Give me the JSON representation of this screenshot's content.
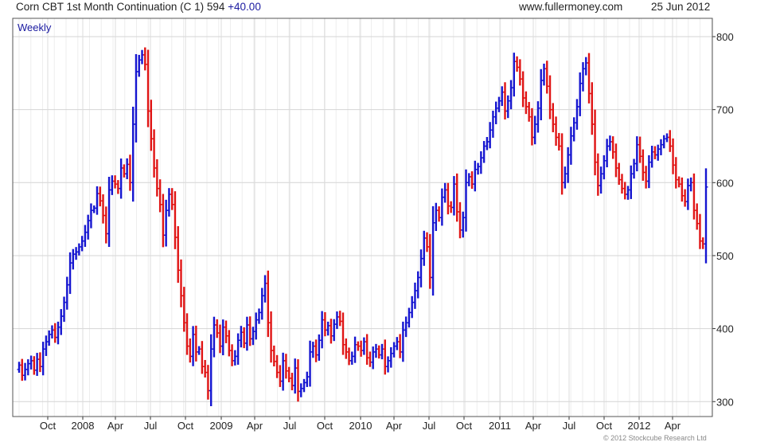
{
  "header": {
    "title_main": "Corn CBT 1st Month Continuation (C 1) 594",
    "title_change": "+40.00",
    "source": "www.fullermoney.com",
    "date": "25 Jun 2012"
  },
  "chart_label": "Weekly",
  "copyright": "© 2012 Stockcube Research Ltd",
  "colors": {
    "up": "#1515d0",
    "down": "#e01414",
    "grid": "#d4d4d4",
    "axis": "#333333"
  },
  "chart_data": {
    "type": "ohlc-bar",
    "title": "Corn CBT 1st Month Continuation (C 1) 594 +40.00",
    "period": "Weekly",
    "ylim": [
      280,
      810
    ],
    "yticks": [
      300,
      400,
      500,
      600,
      700,
      800
    ],
    "xlabels": [
      "Oct",
      "2008",
      "Apr",
      "Jul",
      "Oct",
      "2009",
      "Apr",
      "Jul",
      "Oct",
      "2010",
      "Apr",
      "Jul",
      "Oct",
      "2011",
      "Apr",
      "Jul",
      "Oct",
      "2012",
      "Apr"
    ],
    "grid": true,
    "legend": "none",
    "closes": [
      350,
      336,
      344,
      352,
      356,
      343,
      358,
      348,
      372,
      382,
      392,
      398,
      388,
      402,
      417,
      436,
      460,
      490,
      502,
      505,
      512,
      520,
      532,
      548,
      562,
      565,
      585,
      575,
      555,
      530,
      590,
      602,
      598,
      592,
      620,
      612,
      625,
      600,
      680,
      752,
      768,
      775,
      762,
      698,
      660,
      620,
      592,
      570,
      528,
      562,
      584,
      570,
      525,
      480,
      445,
      408,
      376,
      362,
      392,
      368,
      372,
      348,
      340,
      315,
      372,
      405,
      394,
      376,
      402,
      390,
      370,
      356,
      362,
      384,
      395,
      380,
      405,
      386,
      396,
      412,
      422,
      445,
      462,
      408,
      370,
      355,
      340,
      328,
      356,
      342,
      332,
      322,
      346,
      314,
      318,
      326,
      334,
      368,
      376,
      364,
      384,
      412,
      398,
      404,
      390,
      406,
      416,
      410,
      378,
      368,
      356,
      362,
      378,
      376,
      370,
      382,
      360,
      354,
      368,
      372,
      364,
      372,
      348,
      356,
      366,
      376,
      382,
      368,
      398,
      408,
      422,
      436,
      452,
      470,
      496,
      524,
      512,
      470,
      545,
      562,
      552,
      580,
      590,
      568,
      566,
      598,
      560,
      535,
      552,
      600,
      608,
      598,
      618,
      622,
      634,
      650,
      656,
      672,
      690,
      702,
      712,
      724,
      698,
      712,
      730,
      766,
      758,
      742,
      716,
      704,
      690,
      662,
      680,
      702,
      740,
      756,
      732,
      700,
      680,
      662,
      650,
      600,
      612,
      638,
      664,
      682,
      704,
      736,
      756,
      764,
      722,
      680,
      628,
      596,
      612,
      630,
      650,
      656,
      642,
      620,
      604,
      592,
      584,
      590,
      612,
      626,
      652,
      636,
      614,
      602,
      628,
      642,
      638,
      646,
      652,
      660,
      662,
      650,
      624,
      604,
      598,
      582,
      574,
      596,
      600,
      562,
      544,
      520,
      516,
      594
    ]
  }
}
